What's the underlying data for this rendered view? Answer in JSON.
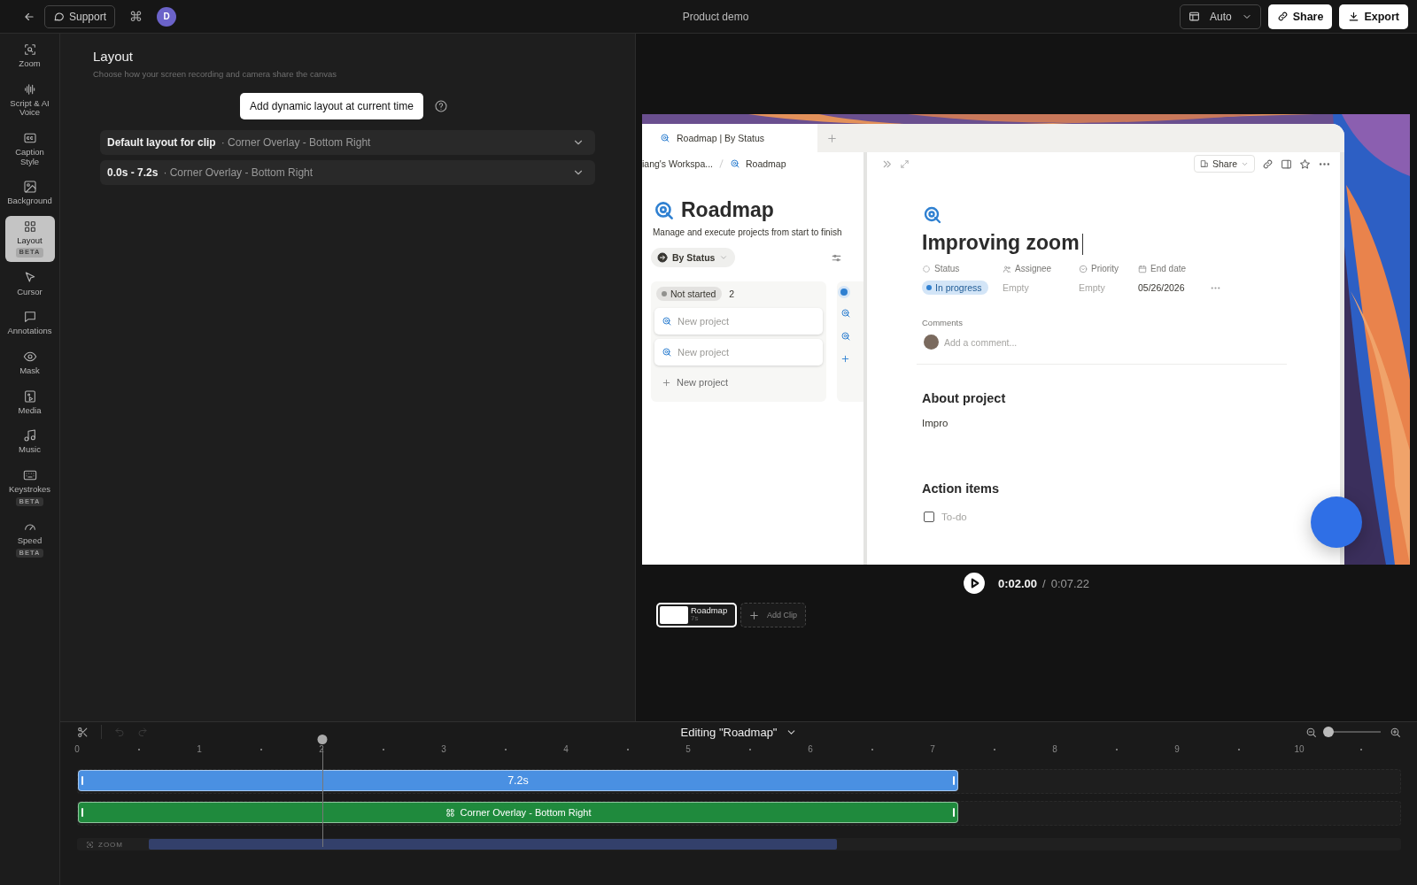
{
  "top_bar": {
    "support": "Support",
    "shortcut": "⌘",
    "avatar": "D",
    "title": "Product demo",
    "layout_select": "Auto",
    "share": "Share",
    "export": "Export"
  },
  "sidebar": {
    "items": [
      {
        "label": "Zoom",
        "selected": false
      },
      {
        "label": "Script & AI Voice",
        "selected": false
      },
      {
        "label": "Caption Style",
        "selected": false
      },
      {
        "label": "Background",
        "selected": false
      },
      {
        "label": "Layout",
        "badge": "BETA",
        "selected": true
      },
      {
        "label": "Cursor",
        "selected": false
      },
      {
        "label": "Annotations",
        "selected": false
      },
      {
        "label": "Mask",
        "selected": false
      },
      {
        "label": "Media",
        "selected": false
      },
      {
        "label": "Music",
        "selected": false
      },
      {
        "label": "Keystrokes",
        "badge": "BETA",
        "selected": false
      },
      {
        "label": "Speed",
        "badge": "BETA",
        "selected": false
      }
    ]
  },
  "layout_panel": {
    "title": "Layout",
    "subtitle": "Choose how your screen recording and camera share the canvas",
    "add_button": "Add dynamic layout at current time",
    "rows": [
      {
        "label": "Default layout for clip",
        "value": "· Corner Overlay - Bottom Right"
      },
      {
        "label": "0.0s - 7.2s",
        "value": "· Corner Overlay - Bottom Right"
      }
    ]
  },
  "preview": {
    "recording": {
      "tab": "Roadmap | By Status",
      "breadcrumb": [
        "iang's Workspa...",
        "Roadmap"
      ],
      "database": {
        "title": "Roadmap",
        "description": "Manage and execute projects from start to finish",
        "view": "By Status",
        "group": "Not started",
        "count": "2",
        "cards": [
          "New project",
          "New project"
        ],
        "add_card": "New project"
      },
      "page": {
        "share": "Share",
        "title": "Improving zoom",
        "properties": [
          {
            "kind": "status",
            "label": "Status",
            "value": "In progress"
          },
          {
            "kind": "empty",
            "label": "Assignee",
            "value": "Empty"
          },
          {
            "kind": "empty",
            "label": "Priority",
            "value": "Empty"
          },
          {
            "kind": "date",
            "label": "End date",
            "value": "05/26/2026"
          }
        ],
        "comments_label": "Comments",
        "comment_placeholder": "Add a comment...",
        "sections": [
          {
            "heading": "About project",
            "body": "Impro"
          },
          {
            "heading": "Action items"
          }
        ],
        "todo": {
          "label": "To-do",
          "checked": false
        }
      }
    },
    "player": {
      "time": "0:02.00",
      "separator": "/",
      "duration": "0:07.22"
    },
    "clips": [
      {
        "name": "Roadmap",
        "duration": "7s",
        "selected": true
      }
    ],
    "add_clip": "Add Clip"
  },
  "timeline": {
    "title": "Editing \"Roadmap\"",
    "undo": {
      "disabled": true
    },
    "redo": {
      "disabled": true
    },
    "zoom_slider": {
      "level": 0.05
    },
    "ruler": [
      "0",
      "1",
      "2",
      "3",
      "4",
      "5",
      "6",
      "7",
      "8",
      "9",
      "10"
    ],
    "playhead": {
      "level": 0.185
    },
    "tracks": [
      {
        "kind": "clip",
        "label": "7.2s",
        "color": "#4a90e2"
      },
      {
        "kind": "layout",
        "label": "Corner Overlay - Bottom Right",
        "color": "#1f8a3d"
      },
      {
        "kind": "zoom",
        "label": "ZOOM"
      }
    ]
  }
}
